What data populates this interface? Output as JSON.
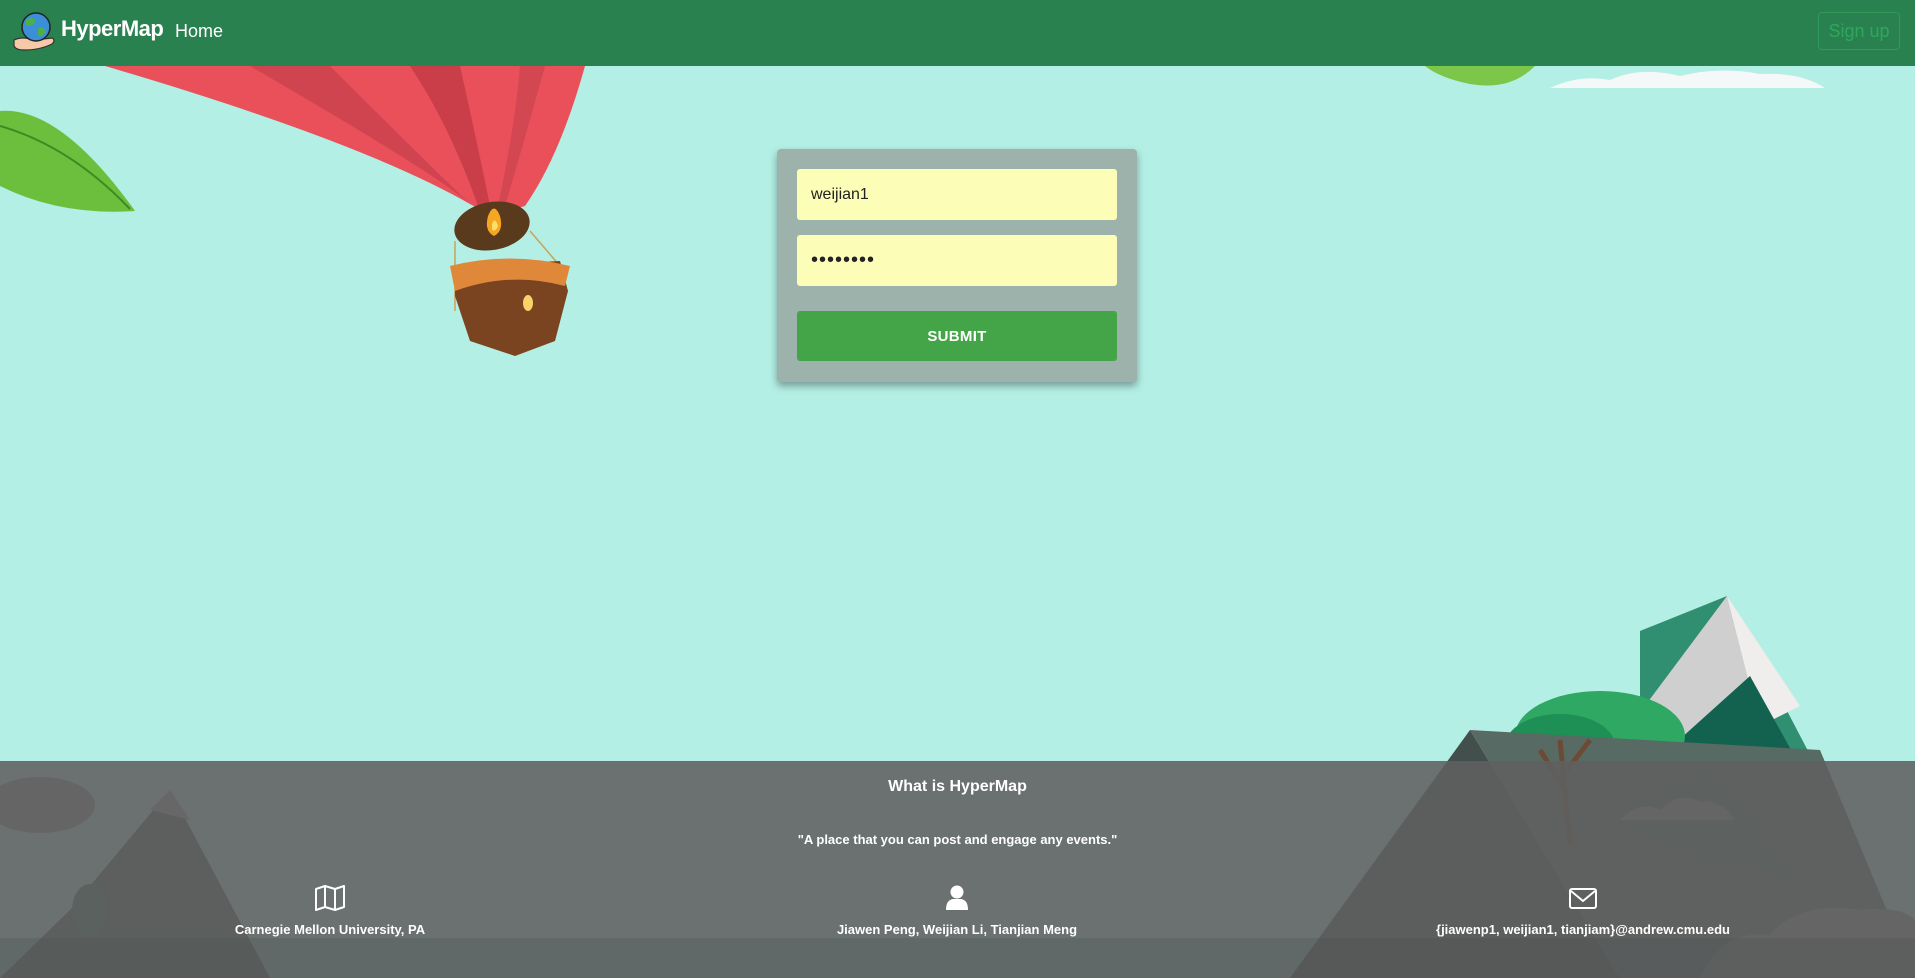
{
  "navbar": {
    "brand": "HyperMap",
    "home_label": "Home",
    "signup_label": "Sign up",
    "logo_icon": "globe-hand-icon"
  },
  "login": {
    "username_value": "weijian1",
    "password_value": "weijian1",
    "submit_label": "SUBMIT"
  },
  "footer": {
    "title": "What is HyperMap",
    "quote": "\"A place that you can post and engage any events.\"",
    "location": "Carnegie Mellon University, PA",
    "authors": "Jiawen Peng, Weijian Li, Tianjian Meng",
    "email": "{jiawenp1, weijian1, tianjiam}@andrew.cmu.edu",
    "icons": [
      "map-icon",
      "user-icon",
      "envelope-icon"
    ]
  },
  "colors": {
    "navbar": "#29814f",
    "background": "#b3efe5",
    "submit": "#44a548",
    "input": "#fcfdb7"
  }
}
